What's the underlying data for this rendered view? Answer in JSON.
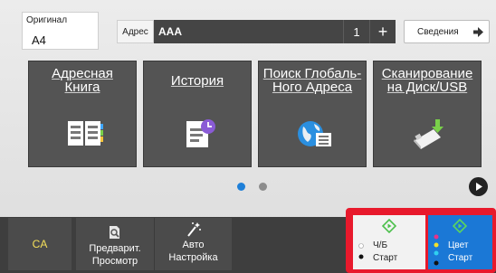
{
  "original": {
    "label": "Оригинал",
    "value": "A4"
  },
  "address": {
    "label": "Адрес",
    "value": "AAA",
    "count": "1",
    "plus": "+",
    "details_label": "Сведения"
  },
  "tiles": [
    {
      "line1": "Адресная",
      "line2": "Книга",
      "icon": "address-book-icon"
    },
    {
      "line1": "История",
      "line2": "",
      "icon": "history-icon"
    },
    {
      "line1": "Поиск Глобаль-",
      "line2": "Ного Адреса",
      "icon": "global-search-icon"
    },
    {
      "line1": "Сканирование",
      "line2": "на Диск/USB",
      "icon": "usb-scan-icon"
    }
  ],
  "pager": {
    "pages": 2,
    "current": 1
  },
  "bottom": {
    "ca_label": "CA",
    "preview": {
      "line1": "Предварит.",
      "line2": "Просмотр"
    },
    "auto": {
      "line1": "Авто",
      "line2": "Настройка"
    },
    "bw_start": {
      "line1": "Ч/Б",
      "line2": "Старт"
    },
    "color_start": {
      "line1": "Цвет",
      "line2": "Старт"
    }
  },
  "colors": {
    "accent": "#1e7fd8",
    "start_highlight": "#e8192c",
    "ca_text": "#f5e05a",
    "color_start_bg": "#1b78d6"
  }
}
